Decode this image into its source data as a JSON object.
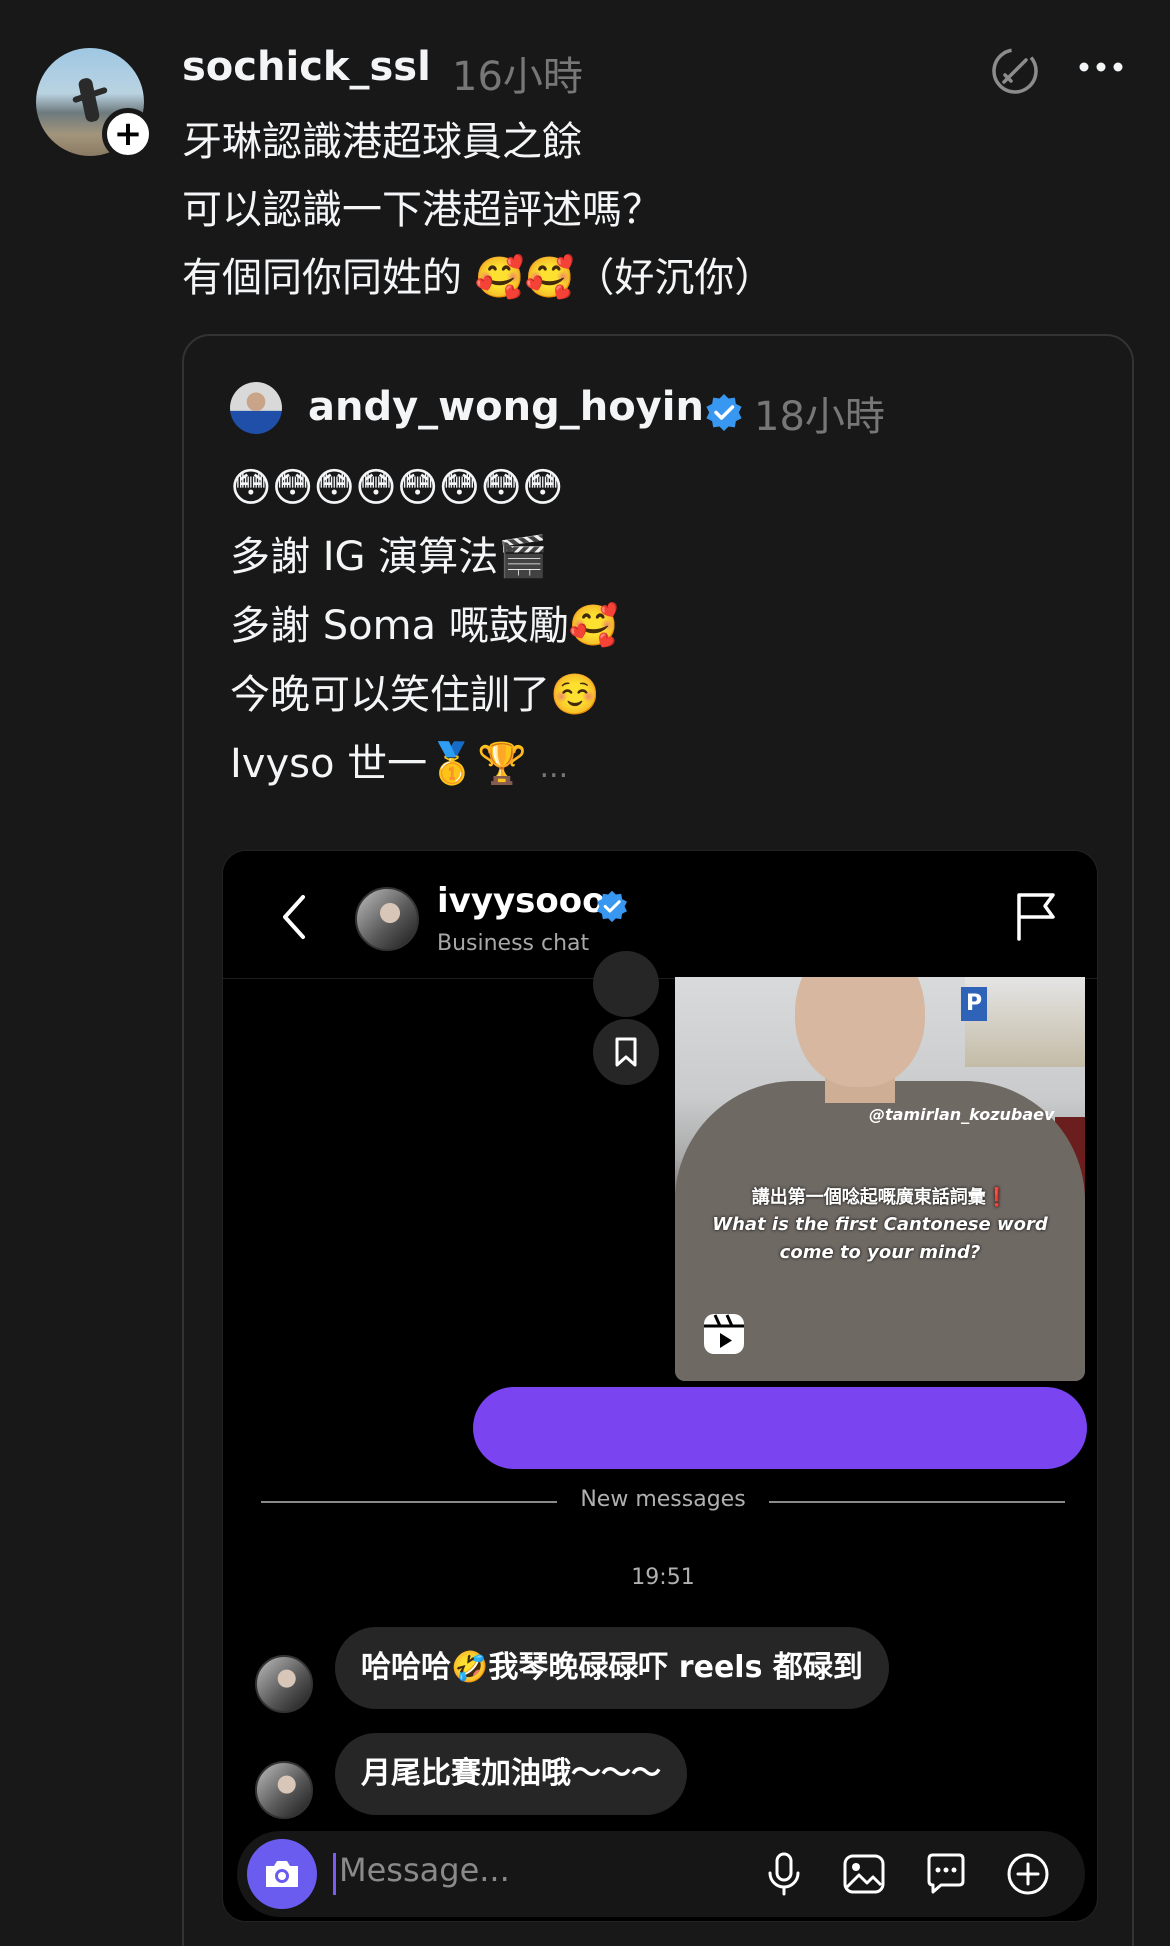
{
  "post": {
    "username": "sochick_ssl",
    "time": "16小時",
    "text": "牙琳認識港超球員之餘\n可以認識一下港超評述嗎？\n有個同你同姓的 🥰🥰（好沉你）"
  },
  "quoted": {
    "username": "andy_wong_hoyin",
    "time": "18小時",
    "text": "😳😳😳😳😳😳😳😳\n多謝 IG 演算法🎬\n多謝 Soma 嘅鼓勵🥰\n今晚可以笑住訓了☺️\nIvyso 世一🥇🏆",
    "more": "..."
  },
  "chat": {
    "name": "ivyysooo",
    "subtitle": "Business chat",
    "reel": {
      "handle": "@tamirlan_kozubaev",
      "caption_zh": "講出第一個唸起嘅廣東話詞彙❗",
      "caption_en": "What is the first Cantonese word\ncome to your mind?",
      "parking_sign": "P"
    },
    "new_messages_label": "New messages",
    "time_label": "19:51",
    "messages": [
      "哈哈哈🤣我琴晚碌碌吓 reels 都碌到",
      "月尾比賽加油哦～～～"
    ],
    "composer_placeholder": "Message..."
  },
  "colors": {
    "background": "#181818",
    "accent_purple": "#7a44f0",
    "verified_blue": "#3897f0",
    "camera_button": "#6b5cf0"
  },
  "icons": {
    "follow": "plus-icon",
    "repost": "repost-icon",
    "more": "more-icon",
    "verified": "verified-icon",
    "back": "chevron-left-icon",
    "flag": "flag-icon",
    "bookmark": "bookmark-icon",
    "reel": "reels-icon",
    "camera": "camera-icon",
    "mic": "microphone-icon",
    "image": "image-icon",
    "sticker": "sticker-icon",
    "plus": "plus-circle-icon"
  }
}
